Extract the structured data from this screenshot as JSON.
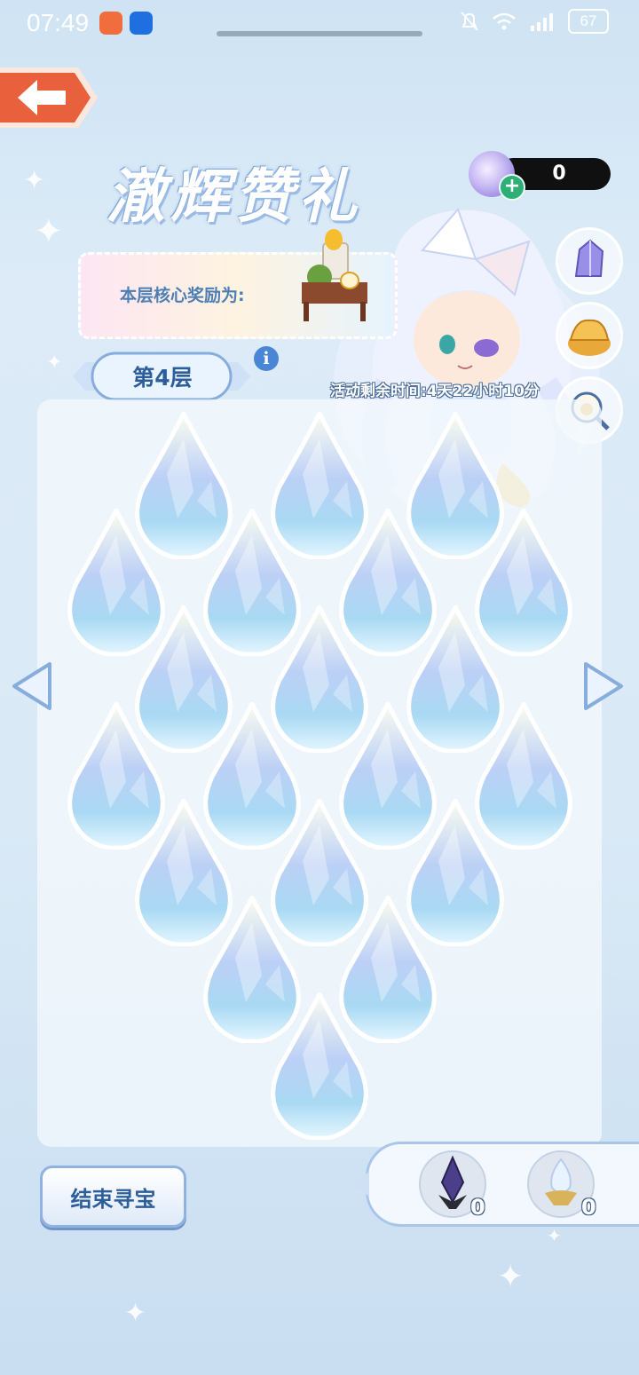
{
  "status_bar": {
    "time": "07:49",
    "battery": "67"
  },
  "event": {
    "title": "澈辉赞礼"
  },
  "currency": {
    "value": "0"
  },
  "reward": {
    "label": "本层核心奖励为:"
  },
  "floor": {
    "label": "第4层"
  },
  "countdown": {
    "text": "活动剩余时间:4天22小时10分"
  },
  "board": {
    "rows": [
      3,
      4,
      3,
      4,
      3,
      2,
      1
    ]
  },
  "bottom": {
    "end_label": "结束寻宝",
    "items": [
      {
        "icon": "dark-crystal-icon",
        "count": "0"
      },
      {
        "icon": "gold-crystal-icon",
        "count": "0"
      }
    ]
  },
  "colors": {
    "accent": "#2d5e9c",
    "back": "#e8613c"
  }
}
